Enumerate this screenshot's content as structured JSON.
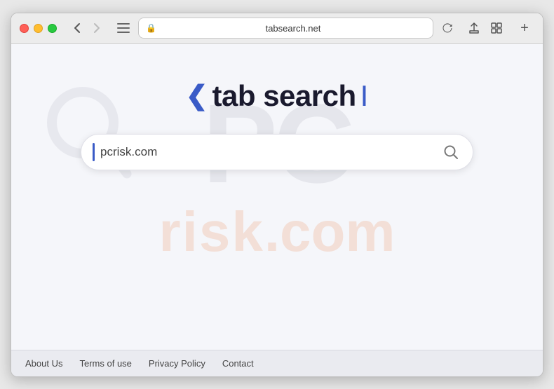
{
  "browser": {
    "url": "tabsearch.net",
    "back_btn": "‹",
    "forward_btn": "›",
    "reload_btn": "↻"
  },
  "page": {
    "title_chevron": "❮",
    "title_text": " tab search",
    "title_cursor": "I",
    "search_placeholder": "pcrisk.com",
    "search_value": "pcrisk.com"
  },
  "watermark": {
    "pc": "PC",
    "risk": "risk",
    "com": ".com"
  },
  "footer": {
    "links": [
      {
        "label": "About Us",
        "name": "about-us-link"
      },
      {
        "label": "Terms of use",
        "name": "terms-link"
      },
      {
        "label": "Privacy Policy",
        "name": "privacy-link"
      },
      {
        "label": "Contact",
        "name": "contact-link"
      }
    ]
  }
}
